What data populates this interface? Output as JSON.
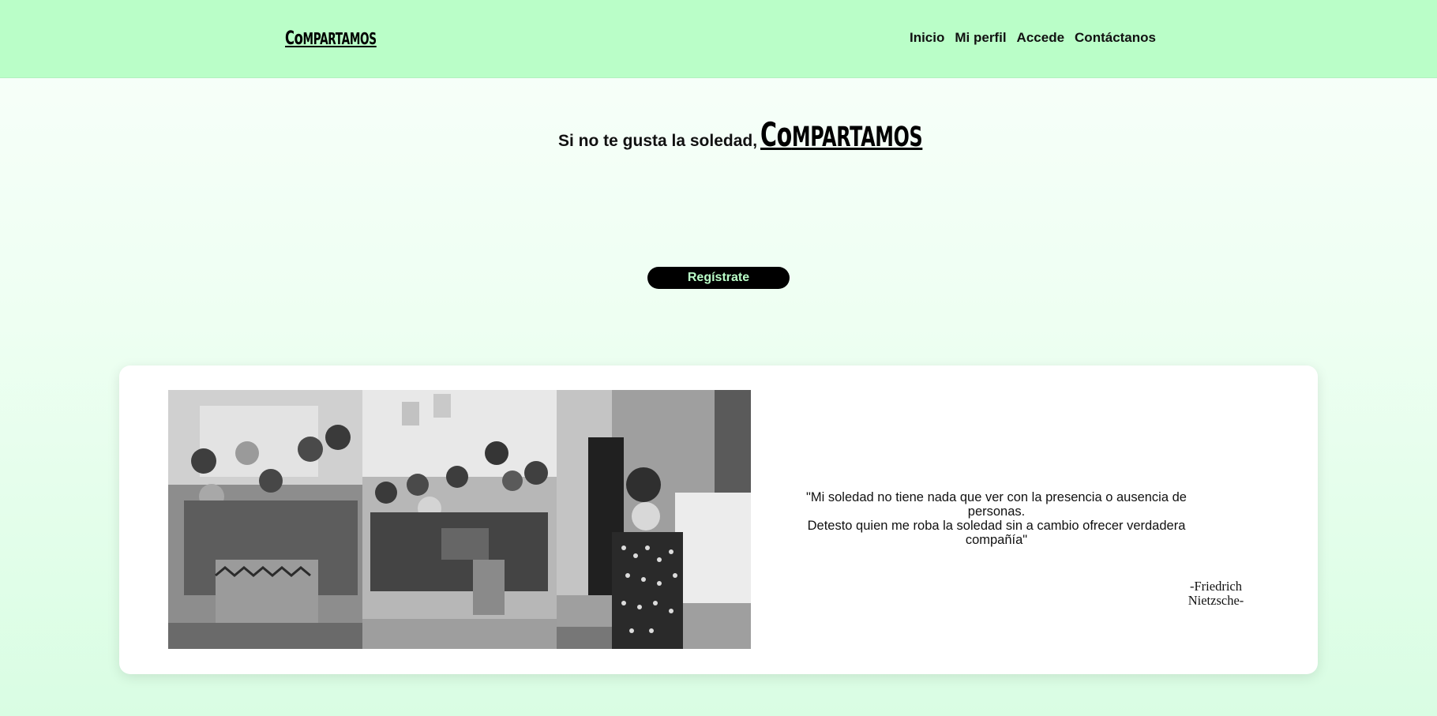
{
  "brand": {
    "logo_first": "Co",
    "logo_rest": "MPARTAMOS"
  },
  "nav": {
    "items": [
      "Inicio",
      "Mi perfil",
      "Accede",
      "Contáctanos"
    ]
  },
  "hero": {
    "tagline": "Si no te gusta la soledad,",
    "cta_label": "Regístrate"
  },
  "quote": {
    "line1": "\"Mi soledad no tiene nada que ver con la presencia o ausencia de personas.",
    "line2": "Detesto quien me roba la soledad sin a cambio ofrecer verdadera compañía\"",
    "author_line1": "-Friedrich",
    "author_line2": "Nietzsche-"
  },
  "photos": [
    {
      "icon": "group-photo"
    },
    {
      "icon": "family-photo"
    },
    {
      "icon": "portrait-photo"
    }
  ],
  "colors": {
    "header_bg": "#bafec8",
    "button_bg": "#000000",
    "button_text": "#bafec8"
  }
}
